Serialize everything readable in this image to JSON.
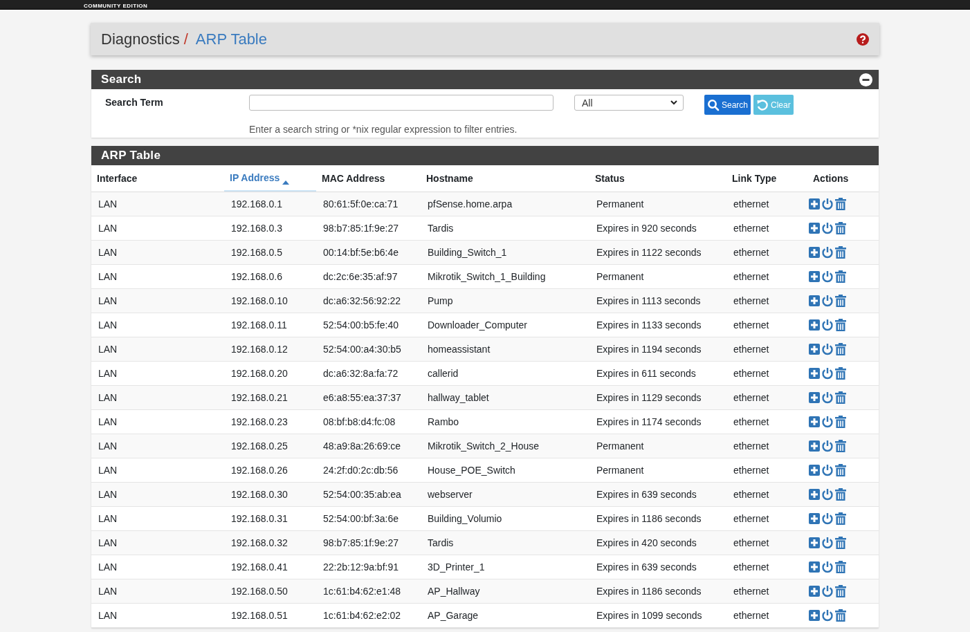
{
  "top_bar": {
    "edition": "COMMUNITY EDITION"
  },
  "breadcrumb": {
    "parent": "Diagnostics",
    "separator": "/",
    "current": "ARP Table"
  },
  "search_panel": {
    "title": "Search",
    "field_label": "Search Term",
    "filter_value": "All",
    "buttons": [
      {
        "kind": "search",
        "label": "Search"
      },
      {
        "kind": "clear",
        "label": "Clear"
      }
    ],
    "help_text": "Enter a search string or *nix regular expression to filter entries."
  },
  "table": {
    "title": "ARP Table",
    "columns": [
      {
        "label": "Interface",
        "sorted": false
      },
      {
        "label": "IP Address",
        "sorted": true
      },
      {
        "label": "MAC Address",
        "sorted": false
      },
      {
        "label": "Hostname",
        "sorted": false
      },
      {
        "label": "Status",
        "sorted": false
      },
      {
        "label": "Link Type",
        "sorted": false
      },
      {
        "label": "Actions",
        "sorted": false
      }
    ],
    "rows": [
      [
        "LAN",
        "192.168.0.1",
        "80:61:5f:0e:ca:71",
        "pfSense.home.arpa",
        "Permanent",
        "ethernet"
      ],
      [
        "LAN",
        "192.168.0.3",
        "98:b7:85:1f:9e:27",
        "Tardis",
        "Expires in 920 seconds",
        "ethernet"
      ],
      [
        "LAN",
        "192.168.0.5",
        "00:14:bf:5e:b6:4e",
        "Building_Switch_1",
        "Expires in 1122 seconds",
        "ethernet"
      ],
      [
        "LAN",
        "192.168.0.6",
        "dc:2c:6e:35:af:97",
        "Mikrotik_Switch_1_Building",
        "Permanent",
        "ethernet"
      ],
      [
        "LAN",
        "192.168.0.10",
        "dc:a6:32:56:92:22",
        "Pump",
        "Expires in 1113 seconds",
        "ethernet"
      ],
      [
        "LAN",
        "192.168.0.11",
        "52:54:00:b5:fe:40",
        "Downloader_Computer",
        "Expires in 1133 seconds",
        "ethernet"
      ],
      [
        "LAN",
        "192.168.0.12",
        "52:54:00:a4:30:b5",
        "homeassistant",
        "Expires in 1194 seconds",
        "ethernet"
      ],
      [
        "LAN",
        "192.168.0.20",
        "dc:a6:32:8a:fa:72",
        "callerid",
        "Expires in 611 seconds",
        "ethernet"
      ],
      [
        "LAN",
        "192.168.0.21",
        "e6:a8:55:ea:37:37",
        "hallway_tablet",
        "Expires in 1129 seconds",
        "ethernet"
      ],
      [
        "LAN",
        "192.168.0.23",
        "08:bf:b8:d4:fc:08",
        "Rambo",
        "Expires in 1174 seconds",
        "ethernet"
      ],
      [
        "LAN",
        "192.168.0.25",
        "48:a9:8a:26:69:ce",
        "Mikrotik_Switch_2_House",
        "Permanent",
        "ethernet"
      ],
      [
        "LAN",
        "192.168.0.26",
        "24:2f:d0:2c:db:56",
        "House_POE_Switch",
        "Permanent",
        "ethernet"
      ],
      [
        "LAN",
        "192.168.0.30",
        "52:54:00:35:ab:ea",
        "webserver",
        "Expires in 639 seconds",
        "ethernet"
      ],
      [
        "LAN",
        "192.168.0.31",
        "52:54:00:bf:3a:6e",
        "Building_Volumio",
        "Expires in 1186 seconds",
        "ethernet"
      ],
      [
        "LAN",
        "192.168.0.32",
        "98:b7:85:1f:9e:27",
        "Tardis",
        "Expires in 420 seconds",
        "ethernet"
      ],
      [
        "LAN",
        "192.168.0.41",
        "22:2b:12:9a:bf:91",
        "3D_Printer_1",
        "Expires in 639 seconds",
        "ethernet"
      ],
      [
        "LAN",
        "192.168.0.50",
        "1c:61:b4:62:e1:48",
        "AP_Hallway",
        "Expires in 1186 seconds",
        "ethernet"
      ],
      [
        "LAN",
        "192.168.0.51",
        "1c:61:b4:62:e2:02",
        "AP_Garage",
        "Expires in 1099 seconds",
        "ethernet"
      ]
    ]
  }
}
